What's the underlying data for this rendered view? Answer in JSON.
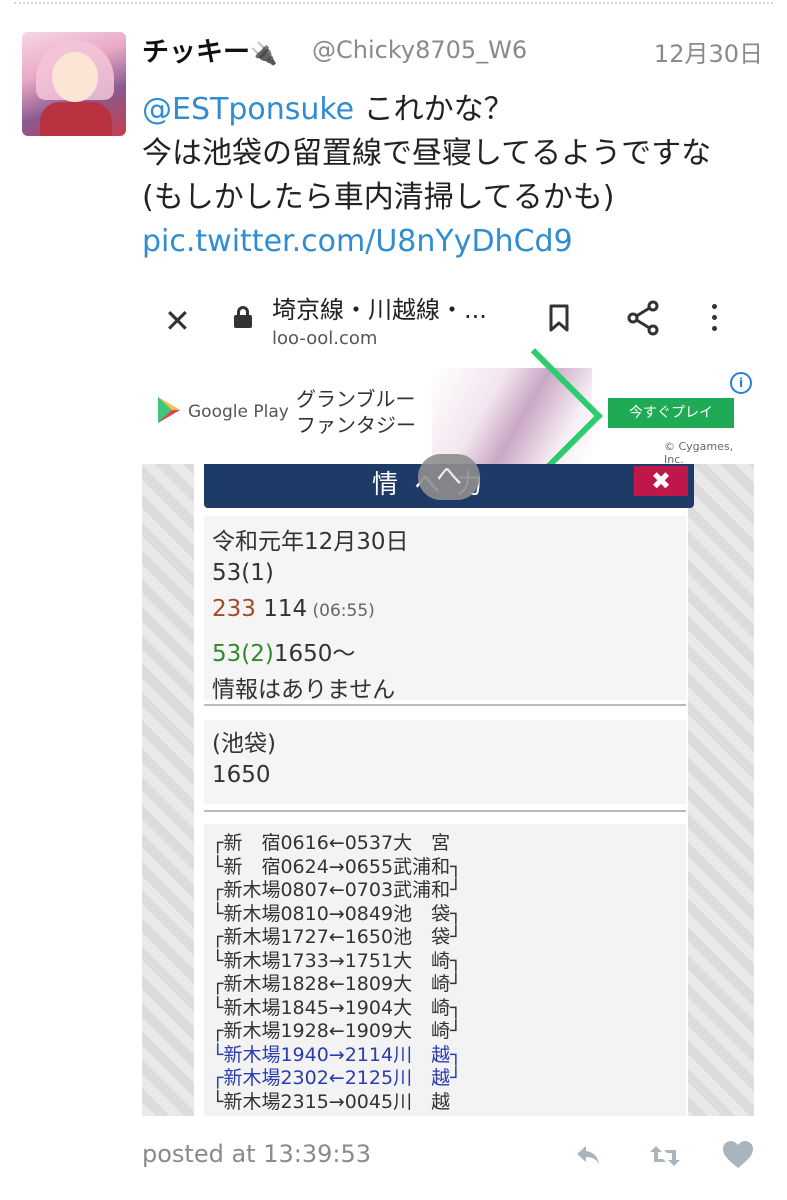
{
  "tweet": {
    "display_name": "チッキー",
    "name_emoji": "🔌",
    "handle": "@Chicky8705_W6",
    "date": "12月30日",
    "mention": "@ESTponsuke",
    "line1_rest": " これかな？",
    "line2": "今は池袋の留置線で昼寝してるようですな",
    "line3": "(もしかしたら車内清掃してるかも)",
    "link": "pic.twitter.com/U8nYyDhCd9",
    "posted_at": "posted at 13:39:53"
  },
  "browser": {
    "page_title": "埼京線・川越線・...",
    "url": "loo-ool.com"
  },
  "ad": {
    "store_label": "Google Play",
    "game_title_line1": "グランブルー",
    "game_title_line2": "ファンタジー",
    "cta": "今すぐプレイ",
    "copyright": "© Cygames, Inc.",
    "info": "i"
  },
  "modal": {
    "header_text": "情 へ 力",
    "close": "✖",
    "scroll_glyph": "へ"
  },
  "info": {
    "date": "令和元年12月30日",
    "item1": "53(1)",
    "item2_num": "233",
    "item2_id": " 114",
    "item2_time": " (06:55)",
    "item3_num": "53(2)",
    "item3_rest": "1650〜",
    "no_info": "情報はありません",
    "station": "(池袋)",
    "station_id": "1650"
  },
  "schedule": {
    "rows": [
      "┌新　宿0616←0537大　宮",
      "└新　宿0624→0655武浦和┐",
      "┌新木場0807←0703武浦和┘",
      "└新木場0810→0849池　袋┐",
      "┌新木場1727←1650池　袋┘",
      "└新木場1733→1751大　崎┐",
      "┌新木場1828←1809大　崎┘",
      "└新木場1845→1904大　崎┐",
      "┌新木場1928←1909大　崎┘",
      "└新木場1940→2114川　越┐",
      "┌新木場2302←2125川　越┘",
      "└新木場2315→0045川　越"
    ],
    "blue_rows": [
      9,
      10
    ]
  },
  "colors": {
    "link": "#2f8dd0",
    "modal_header": "#1e3a66",
    "modal_close": "#c0174a",
    "cta_green": "#1faa55",
    "schedule_blue": "#2a3cb0",
    "green_text": "#2f8a2f",
    "red_text": "#a44a2a"
  },
  "icons": {
    "close": "close-icon",
    "lock": "lock-icon",
    "bookmark": "bookmark-icon",
    "share": "share-icon",
    "menu": "more-vert-icon",
    "reply": "reply-icon",
    "retweet": "retweet-icon",
    "like": "heart-icon"
  }
}
